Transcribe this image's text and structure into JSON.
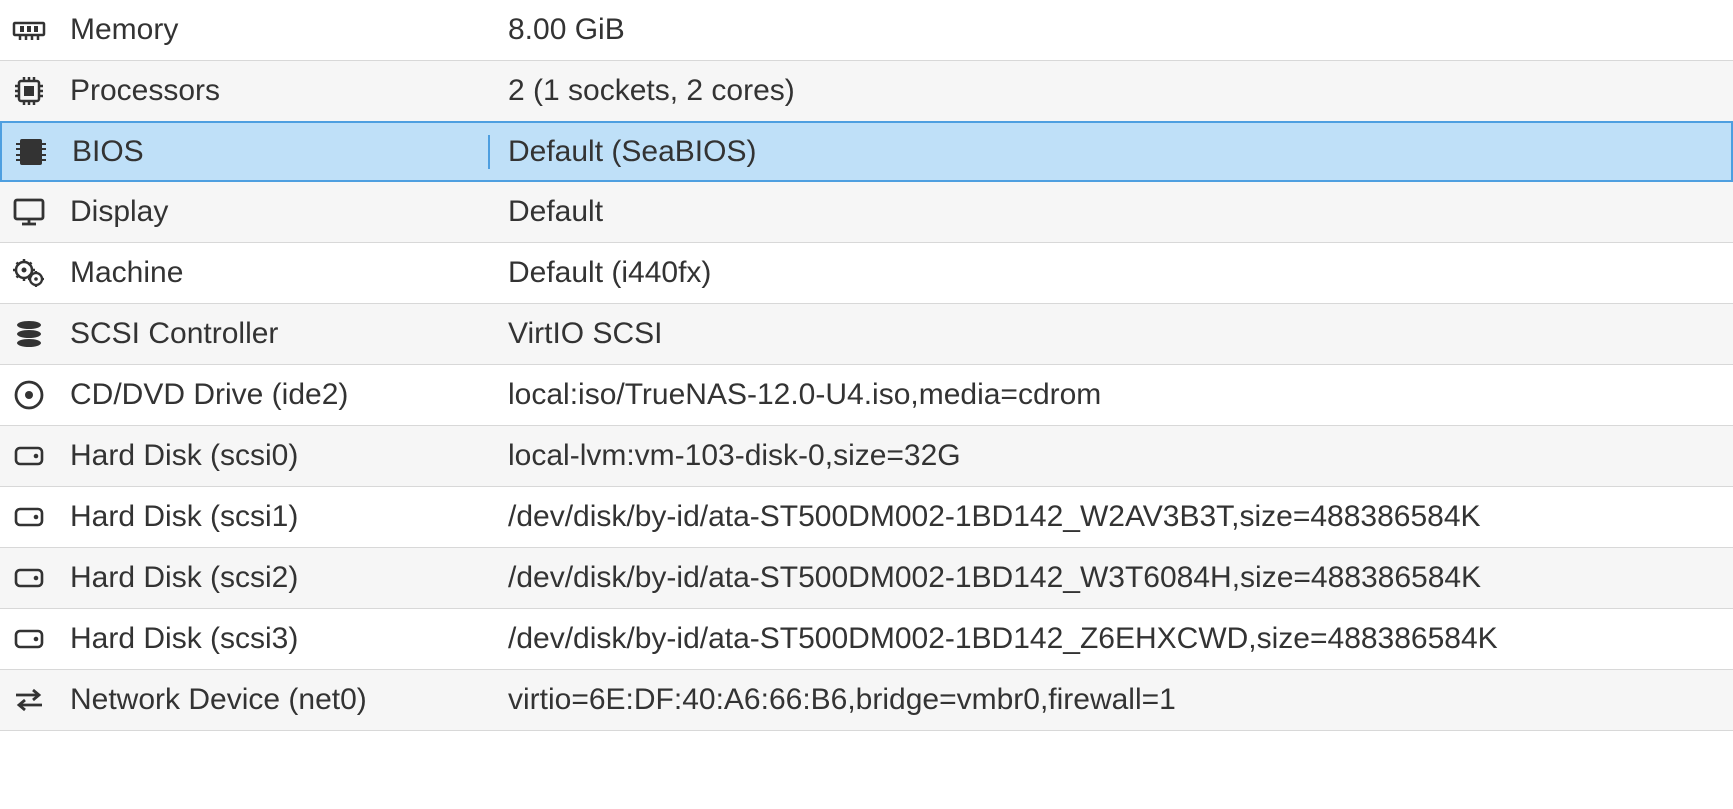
{
  "hardware": {
    "rows": [
      {
        "icon": "memory-icon",
        "label": "Memory",
        "value": "8.00 GiB",
        "selected": false
      },
      {
        "icon": "cpu-icon",
        "label": "Processors",
        "value": "2 (1 sockets, 2 cores)",
        "selected": false
      },
      {
        "icon": "bios-icon",
        "label": "BIOS",
        "value": "Default (SeaBIOS)",
        "selected": true
      },
      {
        "icon": "display-icon",
        "label": "Display",
        "value": "Default",
        "selected": false
      },
      {
        "icon": "machine-icon",
        "label": "Machine",
        "value": "Default (i440fx)",
        "selected": false
      },
      {
        "icon": "scsi-icon",
        "label": "SCSI Controller",
        "value": "VirtIO SCSI",
        "selected": false
      },
      {
        "icon": "disc-icon",
        "label": "CD/DVD Drive (ide2)",
        "value": "local:iso/TrueNAS-12.0-U4.iso,media=cdrom",
        "selected": false
      },
      {
        "icon": "hdd-icon",
        "label": "Hard Disk (scsi0)",
        "value": "local-lvm:vm-103-disk-0,size=32G",
        "selected": false
      },
      {
        "icon": "hdd-icon",
        "label": "Hard Disk (scsi1)",
        "value": "/dev/disk/by-id/ata-ST500DM002-1BD142_W2AV3B3T,size=488386584K",
        "selected": false
      },
      {
        "icon": "hdd-icon",
        "label": "Hard Disk (scsi2)",
        "value": "/dev/disk/by-id/ata-ST500DM002-1BD142_W3T6084H,size=488386584K",
        "selected": false
      },
      {
        "icon": "hdd-icon",
        "label": "Hard Disk (scsi3)",
        "value": "/dev/disk/by-id/ata-ST500DM002-1BD142_Z6EHXCWD,size=488386584K",
        "selected": false
      },
      {
        "icon": "network-icon",
        "label": "Network Device (net0)",
        "value": "virtio=6E:DF:40:A6:66:B6,bridge=vmbr0,firewall=1",
        "selected": false
      }
    ]
  }
}
